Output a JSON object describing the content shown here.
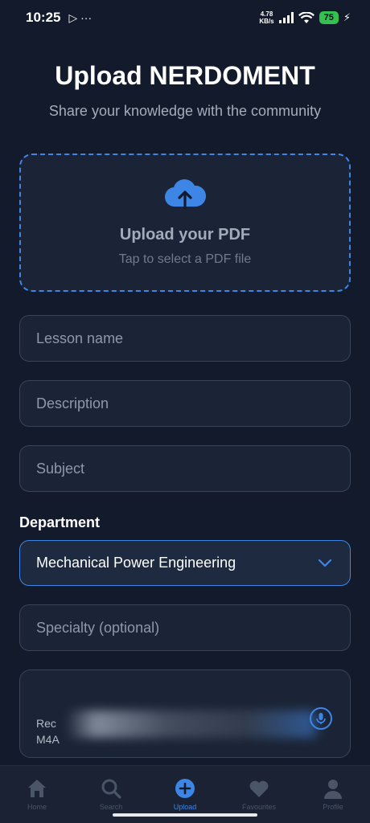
{
  "status_bar": {
    "time": "10:25",
    "extra": "▷ ···",
    "net_speed_value": "4.78",
    "net_speed_unit": "KB/s",
    "battery": "75"
  },
  "header": {
    "title": "Upload NERDOMENT",
    "subtitle": "Share your knowledge with the community"
  },
  "upload": {
    "title": "Upload your PDF",
    "hint": "Tap to select a PDF file",
    "icon": "cloud-upload-icon"
  },
  "form": {
    "lesson_name_placeholder": "Lesson name",
    "description_placeholder": "Description",
    "subject_placeholder": "Subject",
    "department_label": "Department",
    "department_value": "Mechanical Power Engineering",
    "specialty_placeholder": "Specialty (optional)",
    "recording_text": "Rec\nM4A"
  },
  "nav": {
    "items": [
      {
        "label": "Home",
        "icon": "home-icon"
      },
      {
        "label": "Search",
        "icon": "search-icon"
      },
      {
        "label": "Upload",
        "icon": "plus-circle-icon"
      },
      {
        "label": "Favourites",
        "icon": "heart-icon"
      },
      {
        "label": "Profile",
        "icon": "person-icon"
      }
    ],
    "active": "Upload"
  },
  "colors": {
    "background": "#121a2b",
    "accent": "#3e86e6",
    "card": "#1b2436"
  }
}
